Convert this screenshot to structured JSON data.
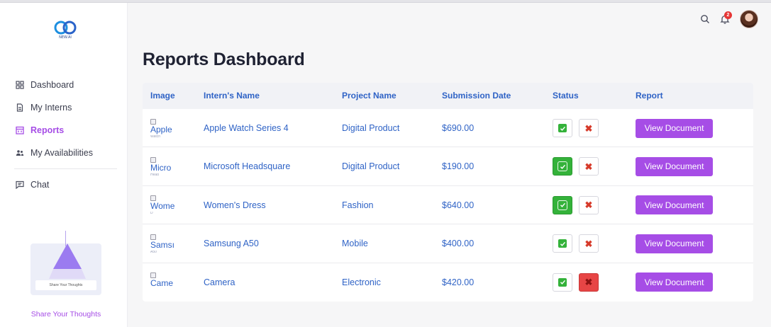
{
  "sidebar": {
    "logo_text": "NEW.AI",
    "items": [
      {
        "label": "Dashboard",
        "icon": "grid-icon"
      },
      {
        "label": "My Interns",
        "icon": "document-icon"
      },
      {
        "label": "Reports",
        "icon": "calendar-icon",
        "active": true
      },
      {
        "label": "My Availabilities",
        "icon": "users-icon"
      },
      {
        "label": "Chat",
        "icon": "chat-icon"
      }
    ],
    "thoughts_card_text": "Share Your Thoughts",
    "thoughts_link": "Share Your Thoughts"
  },
  "topbar": {
    "notification_count": "2"
  },
  "page_title": "Reports Dashboard",
  "table": {
    "headers": [
      "Image",
      "Intern's Name",
      "Project Name",
      "Submission Date",
      "Status",
      "Report"
    ],
    "rows": [
      {
        "image_alt": "Apple",
        "image_alt_tail": "Watch",
        "name": "Apple Watch Series 4",
        "project": "Digital Product",
        "date": "$690.00",
        "approved": false,
        "rejected": false,
        "report": "View Document"
      },
      {
        "image_alt": "Micro",
        "image_alt_tail": "Head",
        "name": "Microsoft Headsquare",
        "project": "Digital Product",
        "date": "$190.00",
        "approved": true,
        "rejected": false,
        "report": "View Document"
      },
      {
        "image_alt": "Wome",
        "image_alt_tail": "D",
        "name": "Women's Dress",
        "project": "Fashion",
        "date": "$640.00",
        "approved": true,
        "rejected": false,
        "report": "View Document"
      },
      {
        "image_alt": "Samsı",
        "image_alt_tail": "A50",
        "name": "Samsung A50",
        "project": "Mobile",
        "date": "$400.00",
        "approved": false,
        "rejected": false,
        "report": "View Document"
      },
      {
        "image_alt": "Came",
        "image_alt_tail": "",
        "name": "Camera",
        "project": "Electronic",
        "date": "$420.00",
        "approved": false,
        "rejected": true,
        "report": "View Document"
      }
    ]
  },
  "colors": {
    "accent": "#a64de6",
    "link": "#2f63c6",
    "approve": "#34b23a",
    "reject": "#e74545"
  }
}
